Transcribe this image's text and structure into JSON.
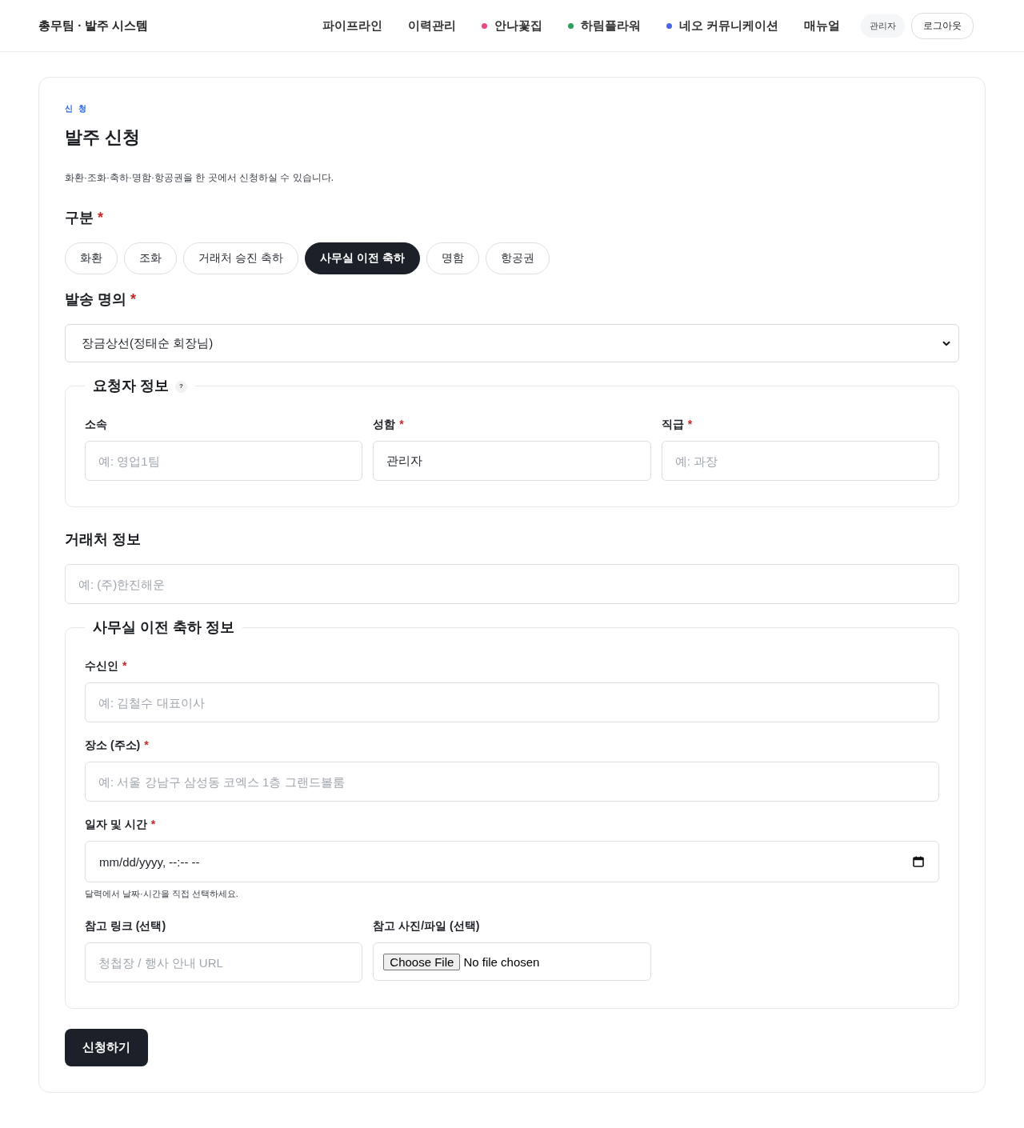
{
  "header": {
    "title": "총무팀 · 발주 시스템",
    "nav": [
      {
        "label": "파이프라인"
      },
      {
        "label": "이력관리"
      },
      {
        "label": "안나꽃집",
        "color": "#e8497f"
      },
      {
        "label": "하림플라워",
        "color": "#2e9e5b"
      },
      {
        "label": "네오 커뮤니케이션",
        "color": "#4a63e8"
      },
      {
        "label": "매뉴얼"
      }
    ],
    "user_badge": "관리자",
    "logout": "로그아웃"
  },
  "form": {
    "eyebrow": "신 청",
    "title": "발주 신청",
    "description": "화환·조화·축하·명함·항공권을 한 곳에서 신청하실 수 있습니다.",
    "category": {
      "label": "구분",
      "required_mark": "*",
      "options": [
        {
          "label": "화환",
          "selected": false
        },
        {
          "label": "조화",
          "selected": false
        },
        {
          "label": "거래처 승진 축하",
          "selected": false
        },
        {
          "label": "사무실 이전 축하",
          "selected": true
        },
        {
          "label": "명함",
          "selected": false
        },
        {
          "label": "항공권",
          "selected": false
        }
      ]
    },
    "sender": {
      "label": "발송 명의",
      "required_mark": "*",
      "value": "장금상선(정태순 회장님)"
    },
    "requester": {
      "legend": "요청자 정보",
      "help": "?",
      "fields": [
        {
          "kind": "text",
          "label": "소속",
          "placeholder": "예: 영업1팀"
        },
        {
          "kind": "text",
          "label": "성함",
          "required_mark": "*",
          "value": "관리자"
        },
        {
          "kind": "text",
          "label": "직급",
          "required_mark": "*",
          "placeholder": "예: 과장"
        }
      ]
    },
    "client": {
      "label": "거래처 정보",
      "placeholder": "예: (주)한진해운"
    },
    "details": {
      "legend": "사무실 이전 축하 정보",
      "fields": [
        {
          "kind": "text",
          "label": "수신인",
          "required_mark": "*",
          "placeholder": "예: 김철수 대표이사"
        },
        {
          "kind": "text",
          "label": "장소 (주소)",
          "required_mark": "*",
          "placeholder": "예: 서울 강남구 삼성동 코엑스 1층 그랜드볼룸"
        },
        {
          "kind": "datetime",
          "label": "일자 및 시간",
          "required_mark": "*",
          "value": "mm/dd/yyyy, --:-- --",
          "hint": "달력에서 날짜·시간을 직접 선택하세요."
        }
      ],
      "extras": [
        {
          "kind": "text",
          "label": "참고 링크 (선택)",
          "placeholder": "청첩장 / 행사 안내 URL"
        },
        {
          "kind": "file",
          "label": "참고 사진/파일 (선택)",
          "button": "Choose File",
          "status": "No file chosen"
        }
      ]
    },
    "submit": "신청하기"
  }
}
